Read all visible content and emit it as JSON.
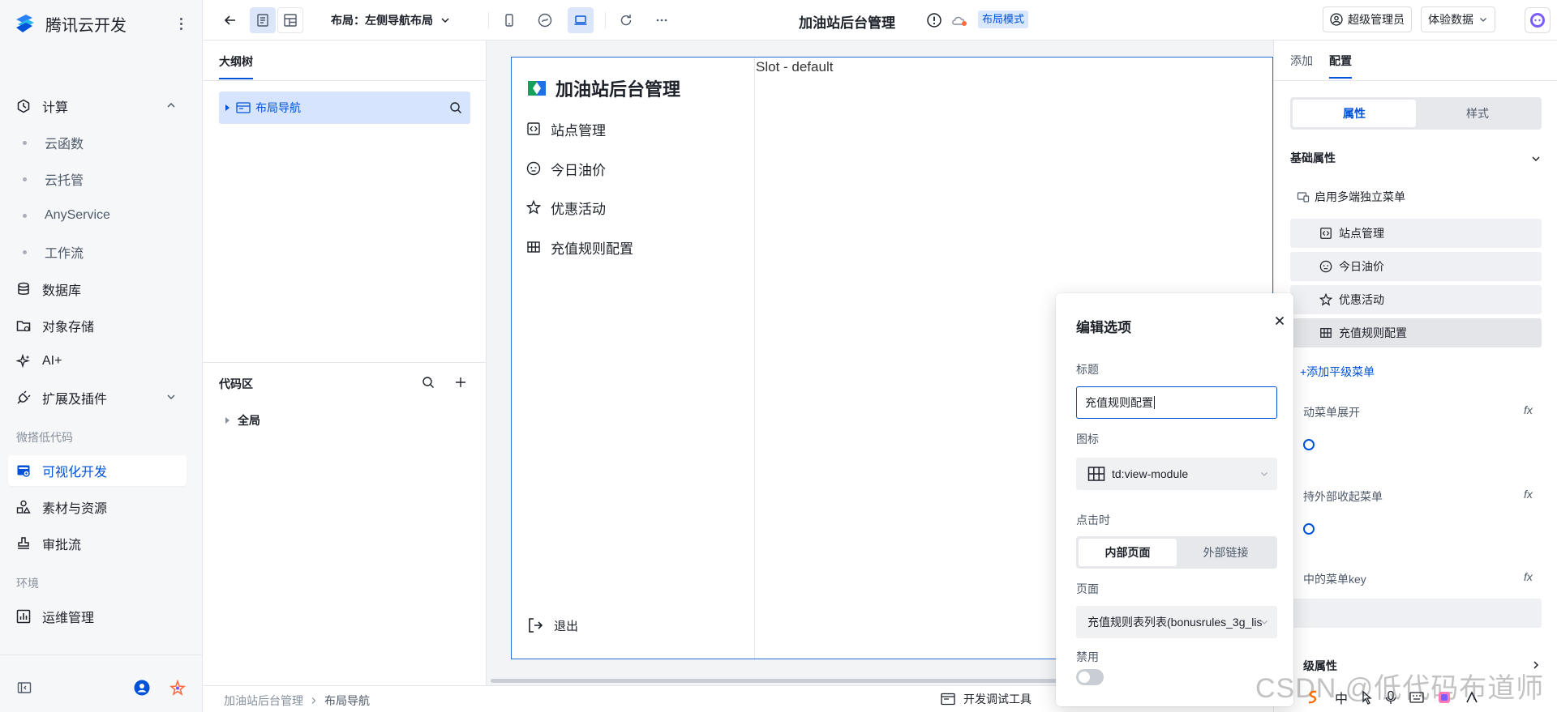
{
  "sidebar": {
    "brand": "腾讯云开发",
    "items": [
      {
        "label": "计算",
        "icon": "hexagon-icon"
      },
      {
        "label": "云函数"
      },
      {
        "label": "云托管"
      },
      {
        "label": "AnyService"
      },
      {
        "label": "工作流"
      },
      {
        "label": "数据库",
        "icon": "database-icon"
      },
      {
        "label": "对象存储",
        "icon": "folder-icon"
      },
      {
        "label": "AI+",
        "icon": "sparkle-icon"
      },
      {
        "label": "扩展及插件",
        "icon": "plug-icon"
      },
      {
        "label": "可视化开发",
        "icon": "visual-dev-icon"
      },
      {
        "label": "素材与资源",
        "icon": "shapes-icon"
      },
      {
        "label": "审批流",
        "icon": "stamp-icon"
      },
      {
        "label": "运维管理",
        "icon": "chart-icon"
      }
    ],
    "groups": [
      "微搭低代码",
      "环境"
    ]
  },
  "toolbar": {
    "layout_label": "布局：左侧导航布局",
    "app_title": "加油站后台管理",
    "mode_badge": "布局模式",
    "admin_label": "超级管理员",
    "data_label": "体验数据"
  },
  "outline": {
    "tab": "大纲树",
    "node": "布局导航",
    "code_title": "代码区",
    "global": "全局"
  },
  "canvas": {
    "brand": "加油站后台管理",
    "menu": [
      "站点管理",
      "今日油价",
      "优惠活动",
      "充值规则配置"
    ],
    "logout": "退出",
    "slot": "Slot - default"
  },
  "statusbar": {
    "crumbs": [
      "加油站后台管理",
      "布局导航"
    ],
    "devtools": "开发调试工具"
  },
  "props": {
    "tabs": [
      "添加",
      "配置"
    ],
    "segments": [
      "属性",
      "样式"
    ],
    "section": "基础属性",
    "multi_menu": "启用多端独立菜单",
    "menu_rows": [
      "站点管理",
      "今日油价",
      "优惠活动",
      "充值规则配置"
    ],
    "add_link": "+添加平级菜单",
    "label_expand": "动菜单展开",
    "label_collapse": "持外部收起菜单",
    "label_key": "中的菜单key",
    "fx": "fx",
    "advanced": "级属性"
  },
  "dialog": {
    "title": "编辑选项",
    "title_label": "标题",
    "title_value": "充值规则配置",
    "icon_label": "图标",
    "icon_value": "td:view-module",
    "click_label": "点击时",
    "click_options": [
      "内部页面",
      "外部链接"
    ],
    "page_label": "页面",
    "page_value": "充值规则表列表(bonusrules_3g_lis",
    "disabled_label": "禁用"
  },
  "watermark": "CSDN @低代码布道师",
  "tray": [
    "中"
  ],
  "colors": {
    "accent": "#0052d9",
    "selected_bg": "#d6e4fd"
  }
}
